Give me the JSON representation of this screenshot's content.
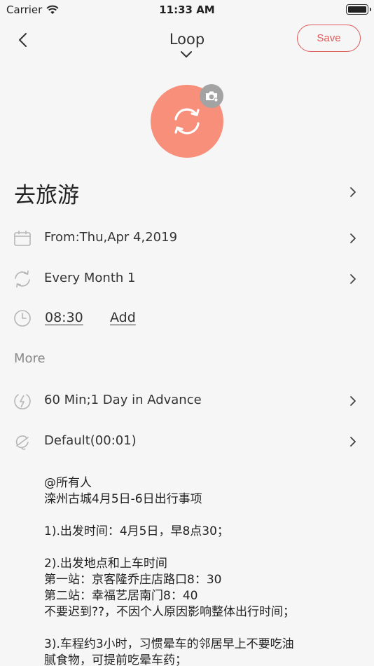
{
  "status_bar": {
    "carrier": "Carrier",
    "time": "11:33 AM"
  },
  "nav": {
    "title": "Loop",
    "save_label": "Save"
  },
  "colors": {
    "accent": "#e05a5a",
    "avatar_bg": "#f78f7a",
    "camera_badge": "#a3a3a3",
    "icon_gray": "#b5b5b5"
  },
  "event": {
    "title": "去旅游"
  },
  "rows": {
    "date": {
      "icon": "calendar-icon",
      "label": "From:Thu,Apr 4,2019"
    },
    "repeat": {
      "icon": "repeat-icon",
      "label": "Every Month 1"
    },
    "time": {
      "icon": "clock-icon",
      "time_value": "08:30",
      "add_label": "Add"
    }
  },
  "more": {
    "section_label": "More",
    "advance": {
      "icon": "lightning-icon",
      "label": "60 Min;1 Day in Advance"
    },
    "sound": {
      "icon": "bell-icon",
      "label": "Default(00:01)"
    }
  },
  "note": {
    "lines": [
      "@所有人",
      "滦州古城4月5日-6日出行事项",
      "",
      "1).出发时间：4月5日，早8点30；",
      "",
      "2).出发地点和上车时间",
      "第一站：京客隆乔庄店路口8：30",
      "第二站：幸福艺居南门8：40",
      "不要迟到??，不因个人原因影响整体出行时间；",
      "",
      "3).车程约3小时，习惯晕车的邻居早上不要吃油",
      "腻食物，可提前吃晕车药；"
    ]
  }
}
